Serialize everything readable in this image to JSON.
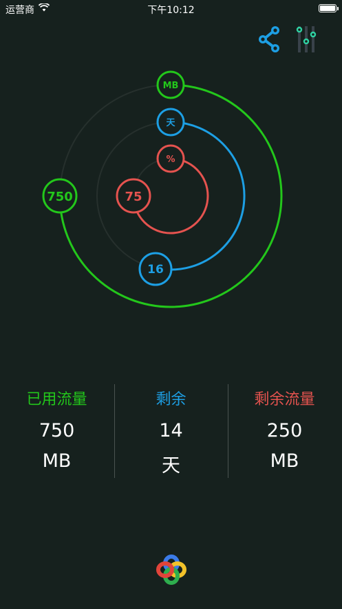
{
  "status_bar": {
    "carrier": "运营商",
    "time": "下午10:12"
  },
  "icons": {
    "share": "share-icon",
    "settings": "sliders-icon",
    "wifi": "wifi-icon",
    "battery": "battery-icon",
    "logo": "app-logo-icon"
  },
  "colors": {
    "background": "#16211e",
    "used": "#23c71b",
    "days": "#1d9fe4",
    "remaining": "#e5534f",
    "share": "#1d9fe4",
    "settings_knob": "#2fd3a3"
  },
  "rings": {
    "outer": {
      "value": "750",
      "unit": "MB",
      "fraction": 0.75
    },
    "middle": {
      "value": "16",
      "unit": "天",
      "fraction": 0.53
    },
    "inner": {
      "value": "75",
      "unit": "%",
      "fraction": 0.75
    }
  },
  "stats": {
    "used": {
      "label": "已用流量",
      "value": "750",
      "unit": "MB"
    },
    "remaining_days": {
      "label": "剩余",
      "value": "14",
      "unit": "天"
    },
    "remaining_traffic": {
      "label": "剩余流量",
      "value": "250",
      "unit": "MB"
    }
  }
}
